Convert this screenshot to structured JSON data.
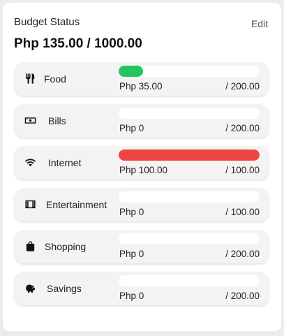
{
  "card": {
    "title": "Budget Status",
    "edit_label": "Edit",
    "total": "Php 135.00 / 1000.00"
  },
  "colors": {
    "under_budget": "#22c55e",
    "over_budget": "#ef4444"
  },
  "categories": [
    {
      "label": "Food",
      "icon": "fork-knife-icon",
      "spent": "Php 35.00",
      "limit": "/ 200.00",
      "progress": 0.175,
      "status": "under"
    },
    {
      "label": "Bills",
      "icon": "cash-icon",
      "spent": "Php 0",
      "limit": "/ 200.00",
      "progress": 0,
      "status": "under"
    },
    {
      "label": "Internet",
      "icon": "wifi-icon",
      "spent": "Php 100.00",
      "limit": "/ 100.00",
      "progress": 1.0,
      "status": "full"
    },
    {
      "label": "Entertainment",
      "icon": "film-icon",
      "spent": "Php 0",
      "limit": "/ 100.00",
      "progress": 0,
      "status": "under"
    },
    {
      "label": "Shopping",
      "icon": "shopping-bag-icon",
      "spent": "Php 0",
      "limit": "/ 200.00",
      "progress": 0,
      "status": "under"
    },
    {
      "label": "Savings",
      "icon": "piggy-bank-icon",
      "spent": "Php 0",
      "limit": "/ 200.00",
      "progress": 0,
      "status": "under"
    }
  ]
}
